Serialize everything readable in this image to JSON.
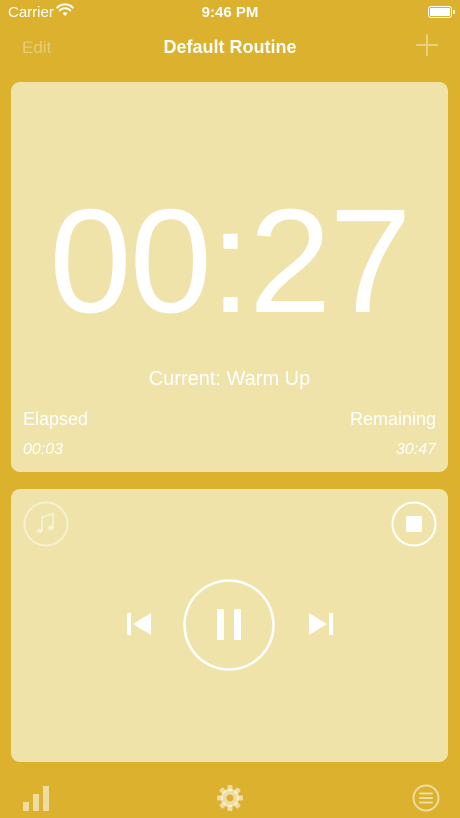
{
  "status_bar": {
    "carrier": "Carrier",
    "time": "9:46 PM"
  },
  "nav": {
    "edit_label": "Edit",
    "title": "Default Routine",
    "add_icon": "plus-icon"
  },
  "timer": {
    "display": "00:27",
    "current": "Current: Warm Up",
    "elapsed_label": "Elapsed",
    "elapsed_value": "00:03",
    "remaining_label": "Remaining",
    "remaining_value": "30:47"
  },
  "controls": {
    "music_icon": "music-note-icon",
    "stop_icon": "stop-icon",
    "prev_icon": "skip-previous-icon",
    "pause_icon": "pause-icon",
    "next_icon": "skip-next-icon"
  },
  "tab_bar": {
    "items": [
      "stats-icon",
      "settings-gear-icon",
      "list-menu-icon"
    ]
  },
  "colors": {
    "background": "#DBB12E",
    "card": "#EFE3AA",
    "text": "#FFFFFF"
  }
}
